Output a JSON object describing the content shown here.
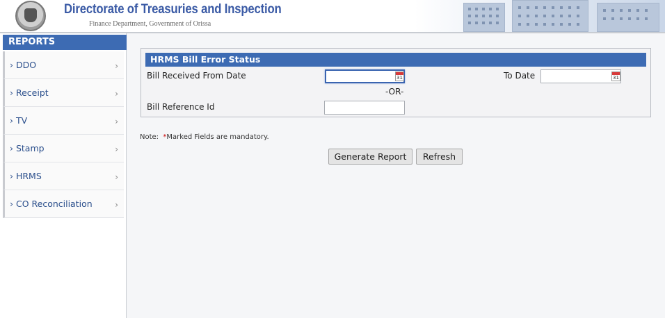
{
  "header": {
    "title": "Directorate of Treasuries and Inspection",
    "subtitle": "Finance Department, Government of Orissa"
  },
  "sidebar": {
    "heading": "REPORTS",
    "items": [
      {
        "label": "› DDO"
      },
      {
        "label": "› Receipt"
      },
      {
        "label": "› TV"
      },
      {
        "label": "› Stamp"
      },
      {
        "label": "› HRMS"
      },
      {
        "label": "› CO Reconciliation"
      }
    ],
    "chevron": "›"
  },
  "form": {
    "title": "HRMS Bill Error Status",
    "from_date_label": "Bill Received From Date",
    "from_date_value": "",
    "to_date_label": "To Date",
    "to_date_value": "",
    "or_label": "-OR-",
    "ref_label": "Bill Reference Id",
    "ref_value": "",
    "calendar_day": "31"
  },
  "note": {
    "prefix": "Note:",
    "star": "*",
    "text": "Marked Fields are mandatory."
  },
  "buttons": {
    "generate": "Generate Report",
    "refresh": "Refresh"
  },
  "colors": {
    "accent": "#3d6bb3",
    "title_blue": "#3a5aa5"
  }
}
